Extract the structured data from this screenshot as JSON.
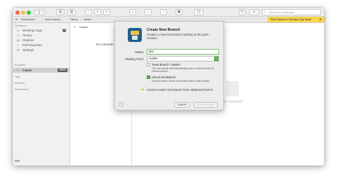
{
  "toolbar": {
    "search_placeholder": "Search for Message"
  },
  "pathbar": {
    "repositories": "Repositories",
    "repo_name": "hello (master)",
    "history": "History",
    "branch": "master"
  },
  "trial": {
    "text": "Trial Expires in 28 Days. Buy Now!"
  },
  "sidebar": {
    "workspace_header": "Workspace",
    "items": [
      {
        "label": "Working Copy",
        "icon": "working-copy-icon",
        "count": "5"
      },
      {
        "label": "History",
        "icon": "clock-icon"
      },
      {
        "label": "Stashes",
        "icon": "box-icon"
      },
      {
        "label": "Pull Requests",
        "icon": "pull-request-icon"
      },
      {
        "label": "Settings",
        "icon": "gear-icon"
      }
    ],
    "branches_header": "Branches",
    "branch_item": "master",
    "head_badge": "HEAD",
    "tags_header": "Tags",
    "remotes_header": "Remotes",
    "submodules_header": "Submodules"
  },
  "list": {
    "header": "master",
    "empty_text": "No commits"
  },
  "detail": {
    "empty_text": "No commit selected"
  },
  "dialog": {
    "title": "Create New Branch",
    "subtitle": "Creates a new local branch starting at the given revision.",
    "name_label": "Name:",
    "name_value": "dev",
    "starting_point_label": "Starting Point:",
    "starting_point_value": "master",
    "track_label": "Track Branch \"master\"",
    "track_desc": "The new branch will automatically push to and pull from the entered branch.",
    "track_checked": false,
    "checkout_label": "Check Out Branch",
    "checkout_desc": "Directly checks out the new branch after it was created.",
    "checkout_checked": true,
    "warning": "Cannot create new branch from orphaned branch.",
    "help": "?",
    "cancel": "Cancel",
    "create": "Create Branch"
  },
  "colors": {
    "trial_bg": "#f9d34a",
    "accent_green": "#4aa63a",
    "focus_ring": "#7cc46a"
  }
}
